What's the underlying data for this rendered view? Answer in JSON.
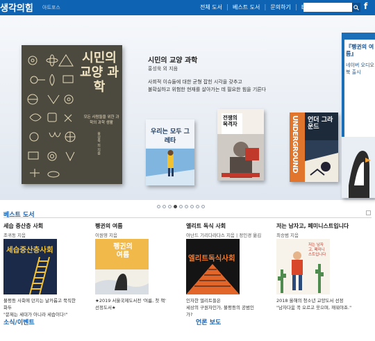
{
  "header": {
    "logo": "생각의힘",
    "logo_sub": "아트포스",
    "nav": [
      "전체 도서",
      "베스트 도서",
      "문의하기",
      "ENG"
    ],
    "search_placeholder": "",
    "search_icon": "search-icon",
    "facebook": "f"
  },
  "hero": {
    "featured": {
      "title": "시민의 교양 과학",
      "author": "홍성욱 외 지음",
      "desc_lines": [
        "사회적 이슈들에 대한 균형 잡힌 시각을 갖추고",
        "불확실하고 위험한 현재를 살아가는 데 필요한 힘을 기른다"
      ],
      "cover_title": "시민의 교양 과학",
      "cover_sub": "모든 사람들을 위한 과학의 과학 생활",
      "cover_author": "홍성욱 외 지음"
    },
    "books": [
      {
        "title": "우리는 모두 그레타"
      },
      {
        "title": "전쟁의 목격자"
      },
      {
        "title": "언더 그라운드",
        "badge": "UNDERGROUND"
      },
      {
        "title": "『펭귄의 여름』",
        "sub": "네이버 오디오북 출시"
      }
    ],
    "dots_count": 9,
    "active_dot": 3
  },
  "bestsellers": {
    "heading": "베스트 도서",
    "items": [
      {
        "title": "세습 중산층 사회",
        "author": "조귀동 지음",
        "cover_text": "세습중산층사회",
        "desc": [
          "불평등 사회에 던지는 날카롭고 묵직한",
          "화두",
          "\"문제는 세대가 아니라 세습이다!\""
        ]
      },
      {
        "title": "펭귄의 여름",
        "author": "이원영 지음",
        "cover_text": "펭귄의 여름",
        "desc": [
          "★2019 서울국제도서전 '여름, 첫 책'",
          "선정도서★"
        ]
      },
      {
        "title": "엘리트 독식 사회",
        "author": "아난드 기리다라다스 지음 | 정인경 옮김",
        "cover_text": "엘리트독식사회",
        "desc": [
          "인자한 엘리트들은",
          "세상의 구원자인가, 불평등의 공범인",
          "가?"
        ]
      },
      {
        "title": "저는 남자고, 페미니스트입니다",
        "author": "최승범 지음",
        "cover_text": "저는 남자고, 페미니스트입니다",
        "desc": [
          "2018 올해의 청소년 교양도서 선정",
          "\"남자다움 꼭 오르고 웃으며, 깨워야죠.\""
        ]
      }
    ]
  },
  "news": {
    "heading": "소식/이벤트"
  },
  "press": {
    "heading": "언론 보도"
  },
  "colors": {
    "brand": "#0e63b3",
    "link": "#1560b0"
  }
}
